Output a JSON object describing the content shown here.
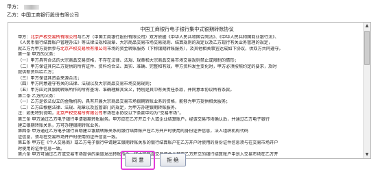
{
  "header": {
    "party_a_label": "甲方：",
    "party_b_label": "乙方：中国工商银行股份有限公司"
  },
  "document": {
    "title": "中国工商银行电子银行集中式银期转账协议",
    "lines": [
      {
        "segments": [
          {
            "text": "    甲方："
          },
          {
            "text": "北京产权交易所有限公司",
            "red": true
          },
          {
            "text": "与乙方（中国工商银行股份有限公司）双方依据《中华人民共和国合同法》、《中华人民共和国商业银行法》、"
          }
        ]
      },
      {
        "segments": [
          {
            "text": "《人民币银行结算账户管理办法》等法律法规和规章、大宗商品交易市场交易规则、结算规则的规定以及乙方现行有关业务管理的规定，"
          }
        ]
      },
      {
        "segments": [
          {
            "text": "就乙方为甲方提供参与"
          },
          {
            "text": "北京产权交易所有限公司",
            "red": true
          },
          {
            "text": "市场的资金转账服务（下称银期转账服务），及其他相关事宜达成如下协议，供双方共同遵守。"
          }
        ]
      },
      {
        "segments": [
          {
            "text": "    第一条  甲方的义务："
          }
        ]
      },
      {
        "segments": [
          {
            "text": "    （一）甲方具有合法的大宗商品交易资格，不存在法律、法规、规章和大宗商品交易市场交易规则禁止或限制的情形；"
          }
        ]
      },
      {
        "segments": [
          {
            "text": "    （二）甲方保证其向乙方提供的所有证件、资料均合法、真实、准确、完整和有效。甲方资料发生变化时，甲方必须按照约定的要求，及时"
          }
        ]
      },
      {
        "segments": [
          {
            "text": "提供新资料给乙方；"
          }
        ]
      },
      {
        "segments": [
          {
            "text": "    （三）甲方保证其资金来源合法；"
          }
        ]
      },
      {
        "segments": [
          {
            "text": "    （四）甲方同意遵守有关的法律、法规以及大宗商品交易市场交易规则；"
          }
        ]
      },
      {
        "segments": [
          {
            "text": "    （五）甲方应对其银期转账所作的所有查询、准确理解其含义，特别是其中有关责任条款，并同意本协议所有条款。"
          }
        ]
      },
      {
        "segments": [
          {
            "text": "    第二条  乙方的义务："
          }
        ]
      },
      {
        "segments": [
          {
            "text": "    （一）乙方是依法设立的金融机构，具有开展大宗商品交易市场银期转账业务的资格，能够为甲方提供相关服务；"
          }
        ]
      },
      {
        "segments": [
          {
            "text": "    （二）乙方应根据法律、法规、规章以及监管部门的规定，为甲方办理银期转账服务。"
          }
        ]
      },
      {
        "segments": [
          {
            "text": "    注：如无特别说明，"
          },
          {
            "text": "北京产权交易所有限公司",
            "red": true
          },
          {
            "text": "市场在本协议以下条款中均为“交易市场”。"
          }
        ]
      },
      {
        "segments": [
          {
            "text": "    第三条  甲方通过乙方电子银行申请银期转账服务。甲方应在乙方开立个人或企业结算账户，经该交易市场确认后，并通过乙方电子银行"
          }
        ]
      },
      {
        "segments": [
          {
            "text": "建立银期转账关系，方可办理银期转账业务。"
          }
        ]
      },
      {
        "segments": [
          {
            "text": "    第四条  甲方通过乙方电子银行自助建立银期转账关系的银行结算账户在乙方开户时使用的身份证件信息，法人组织机构代码"
          }
        ]
      },
      {
        "segments": [
          {
            "text": "证信息，须与在交易市场开户时使用的证件信息一致。"
          }
        ]
      },
      {
        "segments": [
          {
            "text": "    第五条  甲方在《个人交易商》或乙方电子银行申请建立银期转账关系的银行结算账户在乙方开户时使用的身份证件信息须与在交易市场开户"
          }
        ]
      },
      {
        "segments": [
          {
            "text": "时使用的证件信息一致。"
          }
        ]
      },
      {
        "segments": [
          {
            "text": "    第六条  甲方可通过乙方或交易市场提供的渠道发出转账指令，将大宗商品交易资金从其在乙方开立的银行结算账户中划入交易市场在乙方开"
          }
        ]
      }
    ]
  },
  "buttons": {
    "agree": "同 意",
    "reject": "拒 绝"
  }
}
